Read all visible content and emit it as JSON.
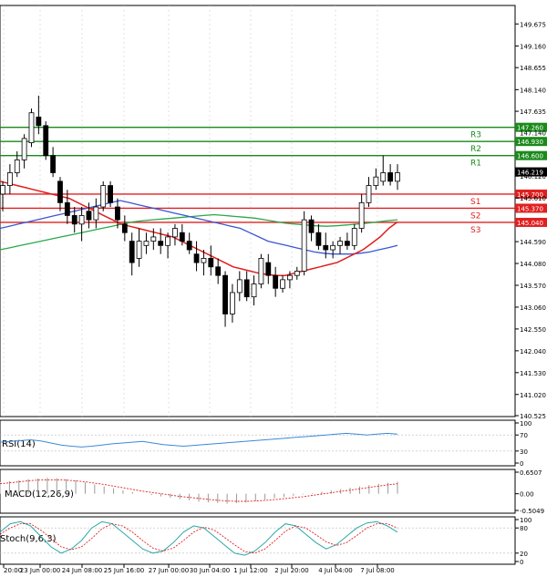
{
  "chart_data": [
    {
      "type": "candlestick",
      "ylim": [
        140.525,
        150.0
      ],
      "price_ticks": [
        "149.675",
        "149.160",
        "148.655",
        "148.140",
        "147.635",
        "146.120",
        "145.610",
        "144.590",
        "144.080",
        "143.570",
        "143.060",
        "142.550",
        "142.040",
        "141.530",
        "141.020",
        "140.525"
      ],
      "x_ticks": [
        "20:00",
        "23 Jun 00:00",
        "24 Jun 08:00",
        "25 Jun 16:00",
        "27 Jun 00:00",
        "30 Jun 04:00",
        "1 Jul 12:00",
        "2 Jul 20:00",
        "4 Jul 04:00",
        "7 Jul 08:00"
      ],
      "levels": [
        {
          "name": "R3",
          "value": 147.26,
          "label": "147.260",
          "color": "#1a8a1a"
        },
        {
          "name": "R2",
          "value": 146.93,
          "label": "146.930",
          "color": "#1a8a1a"
        },
        {
          "name": "R1",
          "value": 146.6,
          "label": "146.600",
          "color": "#1a8a1a"
        },
        {
          "name": "S1",
          "value": 145.7,
          "label": "145.700",
          "color": "#e02020"
        },
        {
          "name": "S2",
          "value": 145.37,
          "label": "145.370",
          "color": "#e02020"
        },
        {
          "name": "S3",
          "value": 145.04,
          "label": "145.040",
          "color": "#e02020"
        }
      ],
      "level_tag_text": [
        "R3",
        "R2",
        "R1",
        "S1",
        "S2",
        "S3"
      ],
      "hidden_tick": "147.140",
      "current_price": {
        "value": 146.219,
        "label": "146.219"
      },
      "candles": [
        {
          "o": 145.7,
          "h": 146.0,
          "l": 145.3,
          "c": 145.9
        },
        {
          "o": 145.9,
          "h": 146.4,
          "l": 145.7,
          "c": 146.2
        },
        {
          "o": 146.2,
          "h": 146.7,
          "l": 146.1,
          "c": 146.5
        },
        {
          "o": 146.5,
          "h": 147.1,
          "l": 146.3,
          "c": 147.0
        },
        {
          "o": 146.9,
          "h": 147.7,
          "l": 146.8,
          "c": 147.6
        },
        {
          "o": 147.5,
          "h": 148.0,
          "l": 147.1,
          "c": 147.3
        },
        {
          "o": 147.3,
          "h": 147.4,
          "l": 146.5,
          "c": 146.6
        },
        {
          "o": 146.6,
          "h": 146.8,
          "l": 146.1,
          "c": 146.2
        },
        {
          "o": 146.0,
          "h": 146.1,
          "l": 145.3,
          "c": 145.5
        },
        {
          "o": 145.5,
          "h": 145.8,
          "l": 145.0,
          "c": 145.2
        },
        {
          "o": 145.2,
          "h": 145.4,
          "l": 144.8,
          "c": 145.0
        },
        {
          "o": 145.0,
          "h": 145.4,
          "l": 144.6,
          "c": 145.2
        },
        {
          "o": 145.3,
          "h": 145.5,
          "l": 144.9,
          "c": 145.1
        },
        {
          "o": 145.1,
          "h": 145.6,
          "l": 144.9,
          "c": 145.4
        },
        {
          "o": 145.4,
          "h": 146.0,
          "l": 145.3,
          "c": 145.9
        },
        {
          "o": 145.9,
          "h": 146.0,
          "l": 145.4,
          "c": 145.5
        },
        {
          "o": 145.4,
          "h": 145.6,
          "l": 144.9,
          "c": 145.1
        },
        {
          "o": 145.0,
          "h": 145.2,
          "l": 144.6,
          "c": 144.8
        },
        {
          "o": 144.6,
          "h": 144.8,
          "l": 143.8,
          "c": 144.1
        },
        {
          "o": 144.2,
          "h": 144.9,
          "l": 144.0,
          "c": 144.6
        },
        {
          "o": 144.5,
          "h": 144.8,
          "l": 144.3,
          "c": 144.6
        },
        {
          "o": 144.6,
          "h": 144.9,
          "l": 144.4,
          "c": 144.7
        },
        {
          "o": 144.6,
          "h": 144.9,
          "l": 144.3,
          "c": 144.5
        },
        {
          "o": 144.5,
          "h": 144.8,
          "l": 144.2,
          "c": 144.7
        },
        {
          "o": 144.7,
          "h": 145.0,
          "l": 144.5,
          "c": 144.9
        },
        {
          "o": 144.8,
          "h": 145.0,
          "l": 144.5,
          "c": 144.6
        },
        {
          "o": 144.6,
          "h": 144.8,
          "l": 144.3,
          "c": 144.4
        },
        {
          "o": 144.3,
          "h": 144.6,
          "l": 143.9,
          "c": 144.1
        },
        {
          "o": 144.1,
          "h": 144.4,
          "l": 143.8,
          "c": 144.2
        },
        {
          "o": 144.2,
          "h": 144.5,
          "l": 143.8,
          "c": 144.0
        },
        {
          "o": 144.0,
          "h": 144.2,
          "l": 143.6,
          "c": 143.8
        },
        {
          "o": 143.8,
          "h": 143.9,
          "l": 142.6,
          "c": 142.9
        },
        {
          "o": 142.9,
          "h": 143.6,
          "l": 142.7,
          "c": 143.4
        },
        {
          "o": 143.4,
          "h": 143.9,
          "l": 143.2,
          "c": 143.7
        },
        {
          "o": 143.7,
          "h": 143.9,
          "l": 143.2,
          "c": 143.3
        },
        {
          "o": 143.3,
          "h": 143.8,
          "l": 143.1,
          "c": 143.6
        },
        {
          "o": 143.6,
          "h": 144.3,
          "l": 143.5,
          "c": 144.2
        },
        {
          "o": 144.1,
          "h": 144.3,
          "l": 143.6,
          "c": 143.8
        },
        {
          "o": 143.8,
          "h": 144.0,
          "l": 143.3,
          "c": 143.5
        },
        {
          "o": 143.5,
          "h": 143.8,
          "l": 143.4,
          "c": 143.7
        },
        {
          "o": 143.7,
          "h": 143.9,
          "l": 143.5,
          "c": 143.8
        },
        {
          "o": 143.8,
          "h": 144.0,
          "l": 143.7,
          "c": 143.9
        },
        {
          "o": 143.9,
          "h": 145.3,
          "l": 143.8,
          "c": 145.1
        },
        {
          "o": 145.1,
          "h": 145.2,
          "l": 144.6,
          "c": 144.8
        },
        {
          "o": 144.8,
          "h": 145.0,
          "l": 144.4,
          "c": 144.5
        },
        {
          "o": 144.5,
          "h": 144.8,
          "l": 144.2,
          "c": 144.4
        },
        {
          "o": 144.4,
          "h": 144.6,
          "l": 144.2,
          "c": 144.5
        },
        {
          "o": 144.5,
          "h": 144.7,
          "l": 144.3,
          "c": 144.6
        },
        {
          "o": 144.6,
          "h": 144.8,
          "l": 144.4,
          "c": 144.5
        },
        {
          "o": 144.5,
          "h": 145.0,
          "l": 144.4,
          "c": 144.9
        },
        {
          "o": 144.9,
          "h": 145.7,
          "l": 144.8,
          "c": 145.5
        },
        {
          "o": 145.5,
          "h": 146.1,
          "l": 145.4,
          "c": 145.9
        },
        {
          "o": 145.9,
          "h": 146.3,
          "l": 145.8,
          "c": 146.1
        },
        {
          "o": 146.0,
          "h": 146.6,
          "l": 145.9,
          "c": 146.2
        },
        {
          "o": 146.2,
          "h": 146.4,
          "l": 145.9,
          "c": 146.0
        },
        {
          "o": 146.0,
          "h": 146.4,
          "l": 145.8,
          "c": 146.2
        }
      ],
      "ma_red": [
        146.0,
        145.95,
        145.9,
        145.85,
        145.8,
        145.75,
        145.7,
        145.65,
        145.6,
        145.5,
        145.4,
        145.3,
        145.2,
        145.1,
        145.0,
        144.95,
        144.9,
        144.85,
        144.8,
        144.75,
        144.7,
        144.6,
        144.5,
        144.4,
        144.3,
        144.2,
        144.1,
        144.0,
        143.95,
        143.9,
        143.85,
        143.82,
        143.8,
        143.8,
        143.85,
        143.9,
        143.95,
        144.0,
        144.05,
        144.1,
        144.2,
        144.3,
        144.4,
        144.55,
        144.7,
        144.9,
        145.05
      ],
      "ma_blue": [
        144.9,
        144.95,
        145.0,
        145.05,
        145.1,
        145.15,
        145.2,
        145.25,
        145.3,
        145.35,
        145.4,
        145.45,
        145.5,
        145.55,
        145.5,
        145.45,
        145.4,
        145.35,
        145.3,
        145.25,
        145.2,
        145.15,
        145.1,
        145.05,
        145.0,
        144.95,
        144.9,
        144.8,
        144.7,
        144.6,
        144.55,
        144.5,
        144.45,
        144.4,
        144.35,
        144.32,
        144.3,
        144.3,
        144.3,
        144.32,
        144.35,
        144.4,
        144.45,
        144.5
      ],
      "ma_green": [
        144.4,
        144.45,
        144.5,
        144.55,
        144.6,
        144.65,
        144.7,
        144.75,
        144.8,
        144.85,
        144.9,
        144.95,
        145.0,
        145.05,
        145.08,
        145.1,
        145.12,
        145.14,
        145.16,
        145.18,
        145.2,
        145.22,
        145.2,
        145.18,
        145.16,
        145.14,
        145.1,
        145.06,
        145.02,
        145.0,
        144.98,
        144.96,
        144.95,
        144.96,
        144.98,
        145.0,
        145.02,
        145.05,
        145.08,
        145.1
      ]
    },
    {
      "type": "line",
      "label": "RSI(14)",
      "y_ticks": [
        "100",
        "70",
        "30",
        "0"
      ],
      "ylim": [
        0,
        100
      ],
      "values": [
        52,
        54,
        56,
        58,
        55,
        50,
        45,
        42,
        40,
        42,
        45,
        48,
        50,
        52,
        54,
        50,
        46,
        44,
        42,
        44,
        46,
        48,
        50,
        52,
        54,
        56,
        58,
        60,
        62,
        64,
        66,
        68,
        70,
        72,
        74,
        72,
        70,
        72,
        74,
        72
      ]
    },
    {
      "type": "bar",
      "label": "MACD(12,26,9)",
      "y_ticks": [
        "0.6507",
        "0.00",
        "-0.5049"
      ],
      "ylim": [
        -0.5049,
        0.6507
      ],
      "values": [
        0.35,
        0.38,
        0.41,
        0.44,
        0.46,
        0.48,
        0.47,
        0.44,
        0.4,
        0.34,
        0.28,
        0.22,
        0.16,
        0.1,
        0.05,
        0.0,
        -0.04,
        -0.08,
        -0.12,
        -0.16,
        -0.2,
        -0.24,
        -0.26,
        -0.28,
        -0.3,
        -0.28,
        -0.26,
        -0.22,
        -0.18,
        -0.14,
        -0.1,
        -0.06,
        -0.02,
        0.02,
        0.06,
        0.1,
        0.14,
        0.18,
        0.22,
        0.26,
        0.3,
        0.33,
        0.36
      ],
      "signal": [
        0.3,
        0.33,
        0.36,
        0.39,
        0.41,
        0.42,
        0.42,
        0.41,
        0.39,
        0.36,
        0.32,
        0.28,
        0.23,
        0.18,
        0.13,
        0.08,
        0.04,
        0.0,
        -0.04,
        -0.08,
        -0.11,
        -0.14,
        -0.17,
        -0.2,
        -0.22,
        -0.23,
        -0.23,
        -0.22,
        -0.2,
        -0.18,
        -0.15,
        -0.12,
        -0.09,
        -0.05,
        -0.01,
        0.03,
        0.07,
        0.11,
        0.15,
        0.19,
        0.23,
        0.27,
        0.3
      ]
    },
    {
      "type": "line",
      "label": "Stoch(9,6,3)",
      "y_ticks": [
        "100",
        "80",
        "20",
        "0"
      ],
      "ylim": [
        0,
        100
      ],
      "k": [
        70,
        90,
        95,
        85,
        60,
        35,
        20,
        30,
        50,
        80,
        95,
        90,
        70,
        50,
        30,
        20,
        25,
        45,
        70,
        85,
        80,
        60,
        40,
        20,
        15,
        25,
        45,
        70,
        90,
        85,
        65,
        45,
        30,
        40,
        60,
        80,
        92,
        95,
        85,
        70
      ],
      "d": [
        65,
        80,
        90,
        90,
        75,
        55,
        35,
        28,
        35,
        55,
        78,
        90,
        85,
        70,
        50,
        32,
        25,
        32,
        50,
        70,
        82,
        75,
        58,
        40,
        24,
        20,
        30,
        50,
        72,
        85,
        80,
        64,
        47,
        38,
        45,
        62,
        80,
        90,
        90,
        80
      ]
    }
  ]
}
